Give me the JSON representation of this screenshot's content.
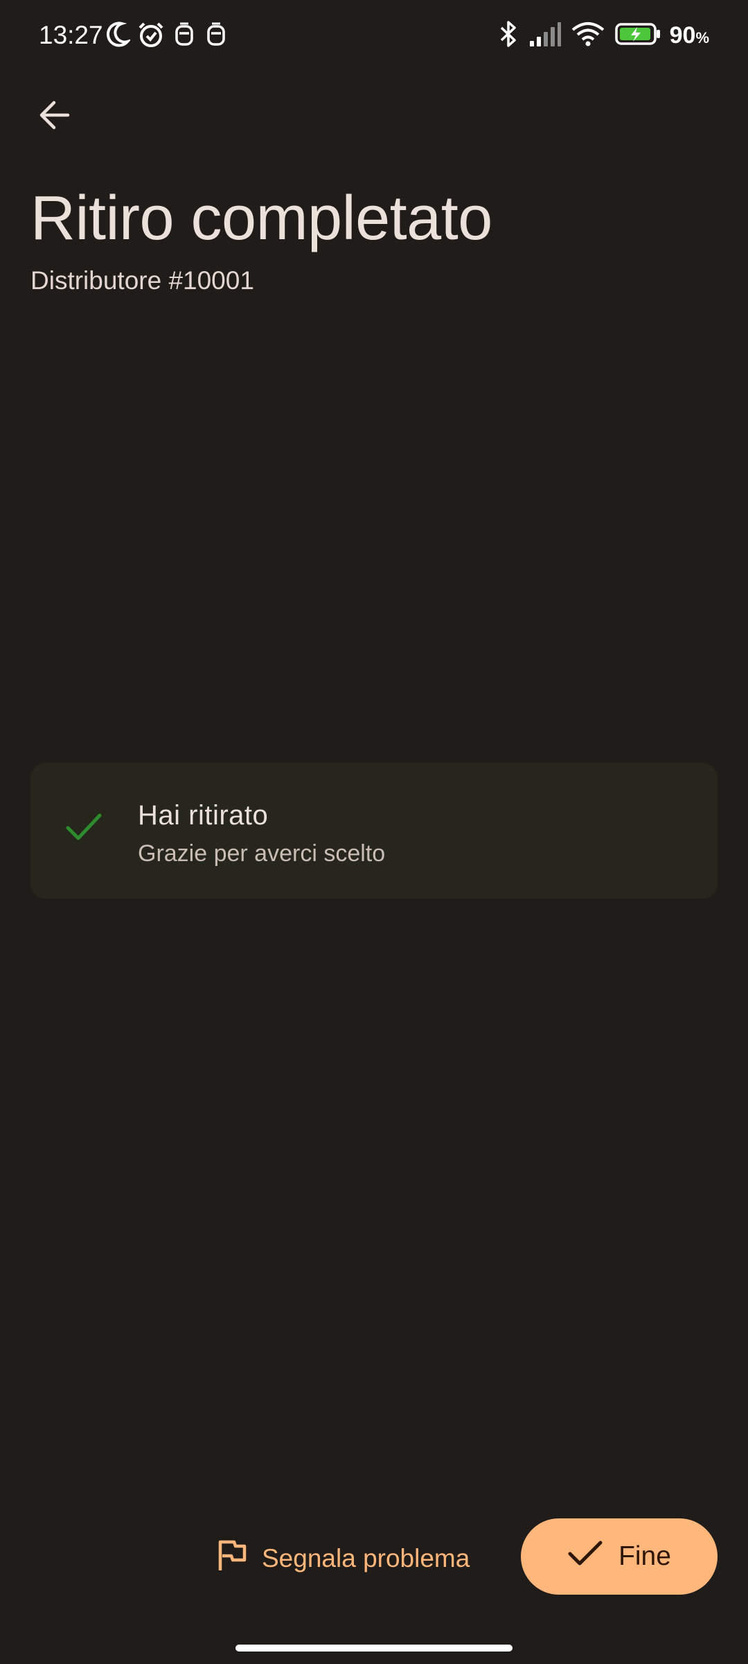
{
  "status_bar": {
    "time": "13:27",
    "battery_percent": "90",
    "battery_unit": "%",
    "icons_left": [
      "moon-icon",
      "alarm-icon",
      "notification-icon",
      "notification-icon"
    ],
    "icons_right": [
      "bluetooth-icon",
      "signal-icon",
      "wifi-icon",
      "battery-charging-icon"
    ]
  },
  "header": {
    "back_icon": "arrow-left-icon",
    "title": "Ritiro completato",
    "subtitle": "Distributore #10001"
  },
  "success_card": {
    "icon": "check-icon",
    "title": "Hai ritirato",
    "message": "Grazie per averci scelto",
    "icon_color": "#2e8b2e"
  },
  "actions": {
    "report_label": "Segnala problema",
    "report_icon": "flag-icon",
    "done_label": "Fine",
    "done_icon": "check-icon"
  },
  "colors": {
    "background": "#201c1a",
    "accent": "#ffb77b",
    "card_background": "#26261d",
    "battery_fill": "#4cc63a"
  }
}
